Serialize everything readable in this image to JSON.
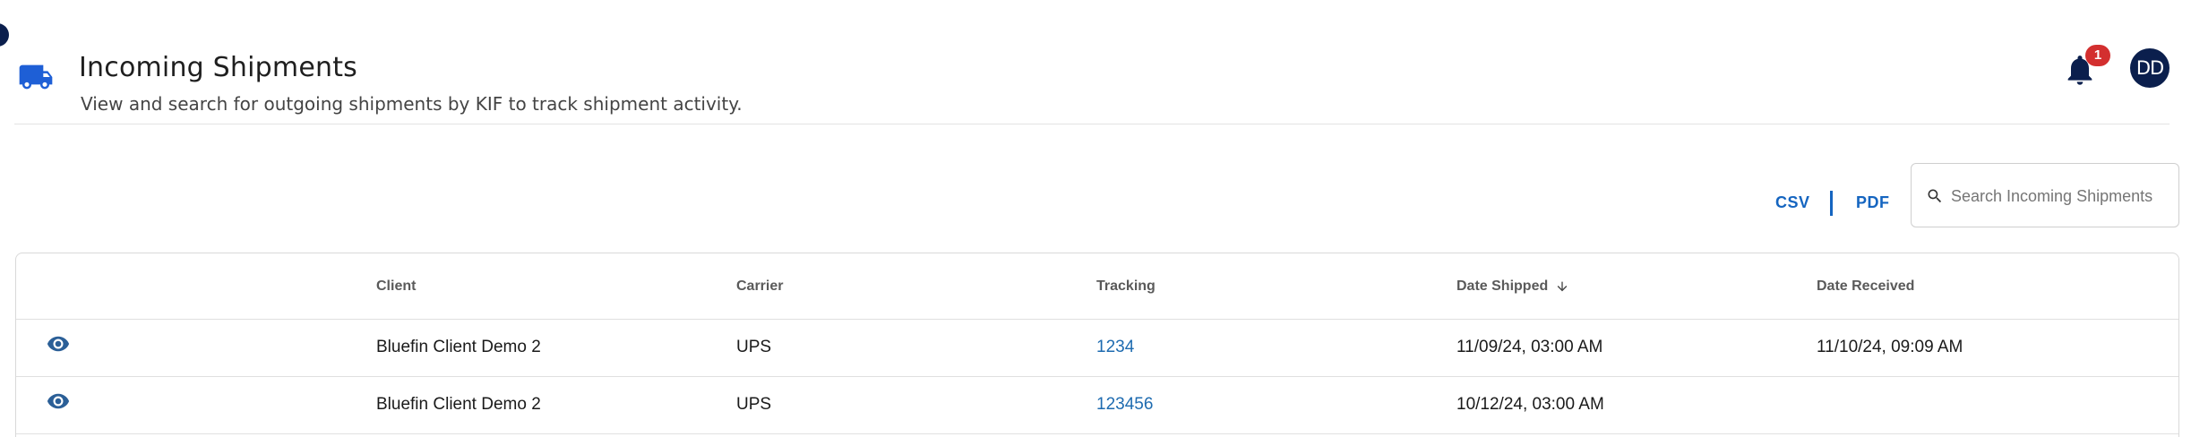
{
  "header": {
    "title": "Incoming Shipments",
    "subtitle": "View and search for outgoing shipments by KIF to track shipment activity.",
    "icon": "truck-icon"
  },
  "notifications": {
    "icon": "bell-icon",
    "count": "1"
  },
  "user": {
    "initials": "DD"
  },
  "exports": {
    "csv_label": "CSV",
    "pdf_label": "PDF"
  },
  "search": {
    "placeholder": "Search Incoming Shipments",
    "value": ""
  },
  "table": {
    "columns": [
      "",
      "Client",
      "Carrier",
      "Tracking",
      "Date Shipped",
      "Date Received"
    ],
    "sorted_column": "Date Shipped",
    "sort_direction": "descending",
    "rows": [
      {
        "client": "Bluefin Client Demo 2",
        "carrier": "UPS",
        "tracking": "1234",
        "date_shipped": "11/09/24, 03:00 AM",
        "date_received": "11/10/24, 09:09 AM"
      },
      {
        "client": "Bluefin Client Demo 2",
        "carrier": "UPS",
        "tracking": "123456",
        "date_shipped": "10/12/24, 03:00 AM",
        "date_received": ""
      }
    ]
  },
  "colors": {
    "brand_navy": "#0b1f4d",
    "link_blue": "#1565c0",
    "badge_red": "#d32f2f",
    "truck_blue": "#1e5fd6"
  }
}
